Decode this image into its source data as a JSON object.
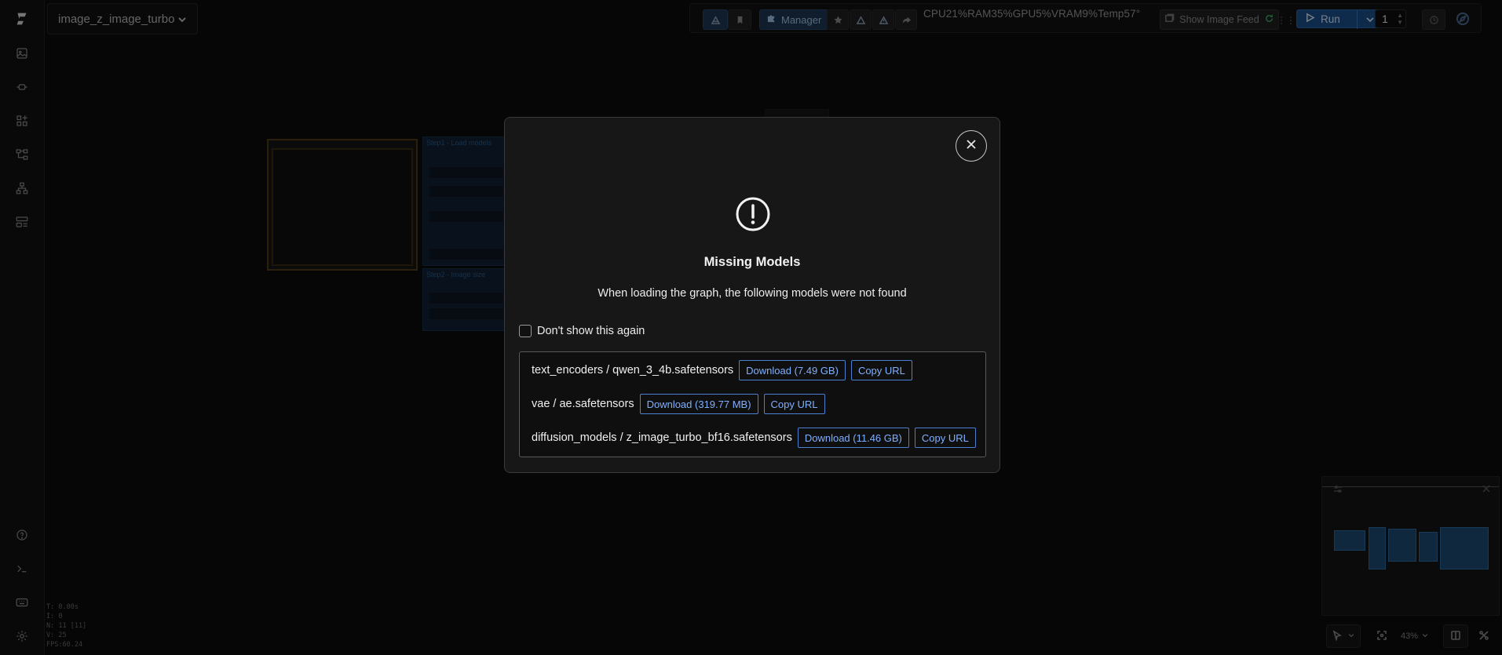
{
  "app": {
    "workflow_name": "image_z_image_turbo"
  },
  "sidebar": {
    "items": [
      {
        "icon": "comfy-logo-icon"
      },
      {
        "icon": "images-icon"
      },
      {
        "icon": "nodes-icon"
      },
      {
        "icon": "model-library-icon"
      },
      {
        "icon": "workflows-icon"
      },
      {
        "icon": "node-library-icon"
      },
      {
        "icon": "templates-icon"
      }
    ],
    "bottom_items": [
      {
        "icon": "help-icon"
      },
      {
        "icon": "terminal-icon"
      },
      {
        "icon": "keyboard-icon"
      },
      {
        "icon": "settings-icon"
      }
    ]
  },
  "toolbar": {
    "manager_label": "Manager",
    "stats_text": "CPU21%RAM35%GPU5%VRAM9%Temp57°",
    "image_feed_label": "Show Image Feed",
    "run_label": "Run",
    "queue_count": "1",
    "colors": {
      "accent": "#1d4f8a",
      "manager": "#1c3550"
    }
  },
  "canvas": {
    "group_labels": [
      "Step1 - Load models",
      "Step2 - Image size"
    ],
    "debug": [
      "T: 0.00s",
      "I: 0",
      "N: 11 [11]",
      "V: 25",
      "FPS:60.24"
    ]
  },
  "controls": {
    "zoom": "43%"
  },
  "dialog": {
    "title": "Missing Models",
    "message": "When loading the graph, the following models were not found",
    "dont_show_label": "Don't show this again",
    "dont_show_checked": false,
    "models": [
      {
        "name": "text_encoders / qwen_3_4b.safetensors",
        "download_label": "Download (7.49 GB)",
        "copy_label": "Copy URL"
      },
      {
        "name": "vae / ae.safetensors",
        "download_label": "Download (319.77 MB)",
        "copy_label": "Copy URL"
      },
      {
        "name": "diffusion_models / z_image_turbo_bf16.safetensors",
        "download_label": "Download (11.46 GB)",
        "copy_label": "Copy URL"
      }
    ],
    "colors": {
      "link_blue": "#7fb0ff",
      "border_blue": "#4b7fd1"
    }
  }
}
